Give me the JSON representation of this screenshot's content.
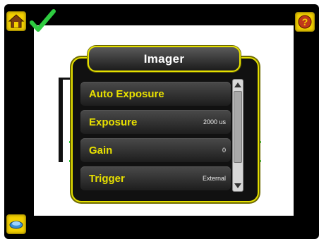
{
  "imager_menu": {
    "title": "Imager",
    "items": [
      {
        "label": "Auto Exposure",
        "value": ""
      },
      {
        "label": "Exposure",
        "value": "2000 us"
      },
      {
        "label": "Gain",
        "value": "0"
      },
      {
        "label": "Trigger",
        "value": "External"
      }
    ]
  },
  "icons": {
    "home": "home-icon",
    "status": "checkmark-icon",
    "help": "help-icon",
    "display": "display-icon"
  },
  "colors": {
    "accent": "#e5e000",
    "status_ok": "#2ecc40",
    "button": "#f3d000"
  }
}
